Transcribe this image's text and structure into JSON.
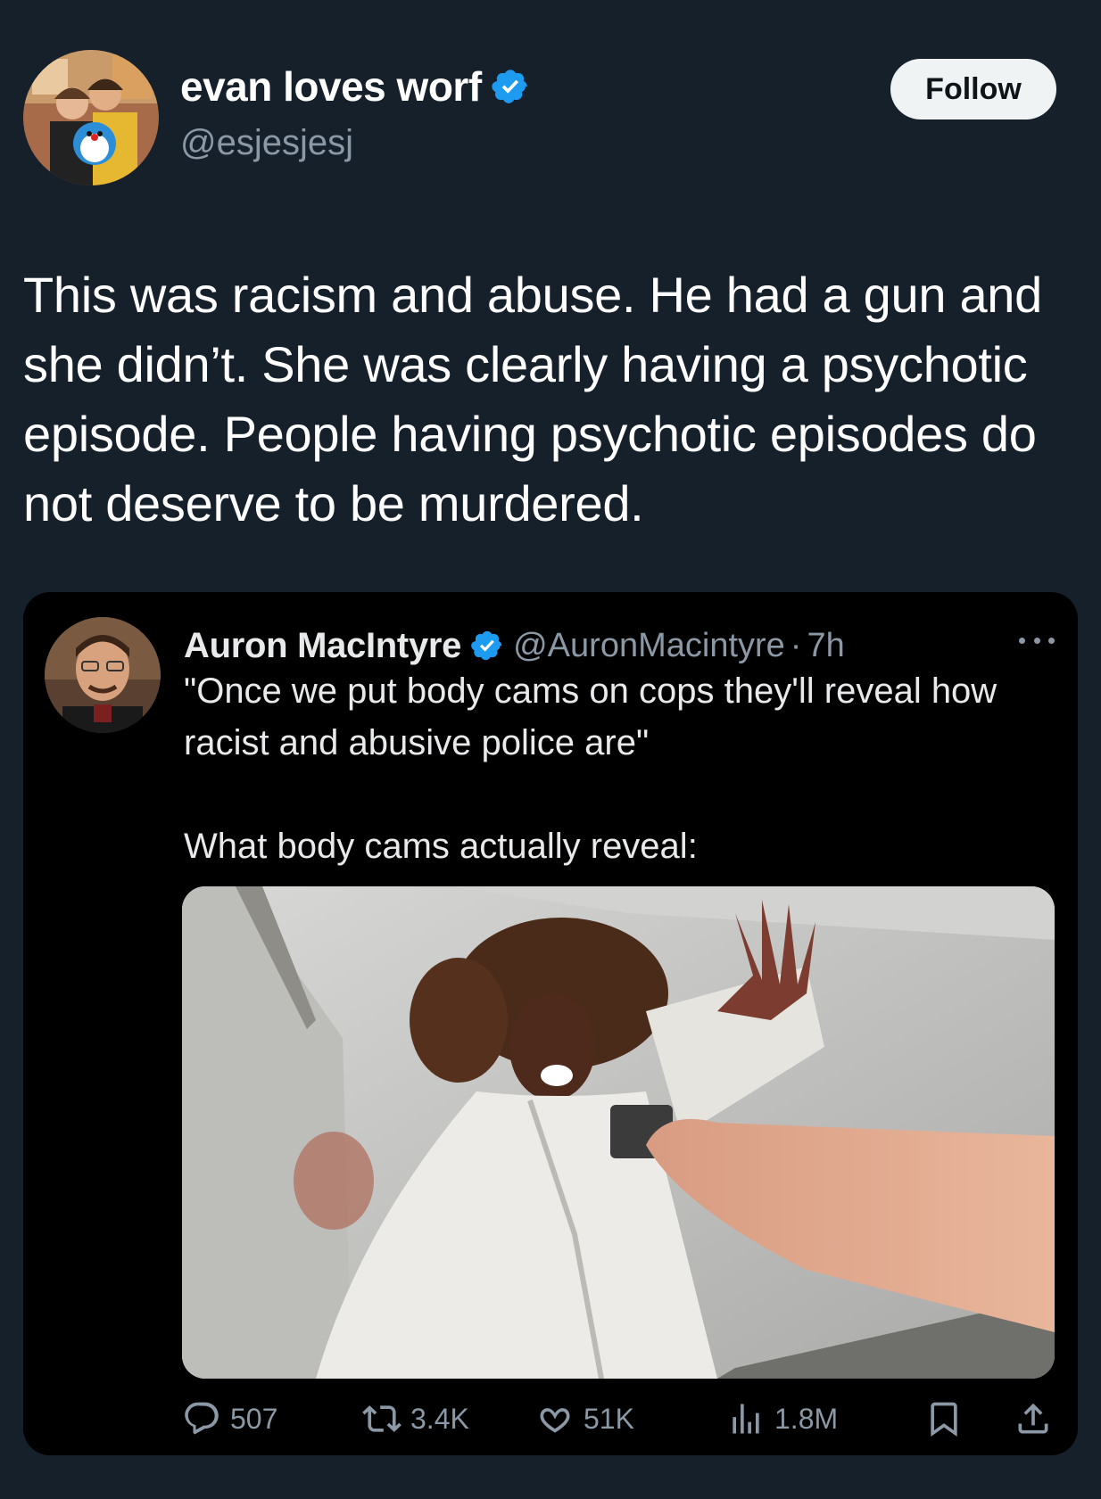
{
  "author": {
    "display_name": "evan loves worf",
    "handle": "@esjesjesj",
    "verified": true,
    "follow_label": "Follow"
  },
  "tweet": {
    "text": "This was racism and abuse. He had a gun and she didn’t. She was clearly having a psychotic episode. People having psychotic episodes do not deserve to be murdered."
  },
  "quoted": {
    "display_name": "Auron MacIntyre",
    "handle": "@AuronMacintyre",
    "separator": "·",
    "time": "7h",
    "verified": true,
    "text": "\"Once we put body cams on cops they'll reveal how racist and abusive police are\"\n\nWhat body cams actually reveal:",
    "stats": {
      "replies": "507",
      "reposts": "3.4K",
      "likes": "51K",
      "views": "1.8M"
    }
  },
  "colors": {
    "background": "#15202b",
    "card": "#000000",
    "muted": "#8b98a5",
    "verified": "#1d9bf0",
    "follow_bg": "#eff3f4"
  },
  "icons": [
    "verified-badge-icon",
    "more-icon",
    "reply-icon",
    "repost-icon",
    "like-icon",
    "views-icon",
    "bookmark-icon",
    "share-icon"
  ]
}
